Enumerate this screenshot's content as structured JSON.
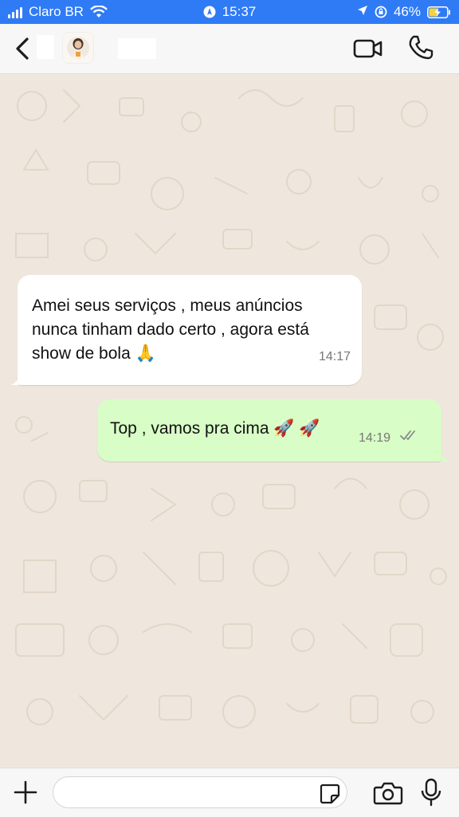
{
  "status_bar": {
    "carrier": "Claro BR",
    "time": "15:37",
    "battery": "46%"
  },
  "header": {
    "back_icon": "chevron-left-icon",
    "video_icon": "video-camera-icon",
    "call_icon": "phone-icon"
  },
  "messages": [
    {
      "direction": "incoming",
      "line1": "Amei seus serviços , meus anúncios",
      "line2": "nunca tinham dado certo , agora está",
      "line3": "show de bola",
      "emoji": "🙏",
      "time": "14:17"
    },
    {
      "direction": "outgoing",
      "text": "Top , vamos pra cima",
      "emoji": "🚀 🚀",
      "time": "14:19",
      "status": "delivered"
    }
  ],
  "input_bar": {
    "placeholder": ""
  },
  "colors": {
    "status_bar": "#2f7bf6",
    "incoming_bubble": "#ffffff",
    "outgoing_bubble": "#d8fdc6",
    "wallpaper": "#efe7de",
    "icon": "#1c1c1c"
  }
}
